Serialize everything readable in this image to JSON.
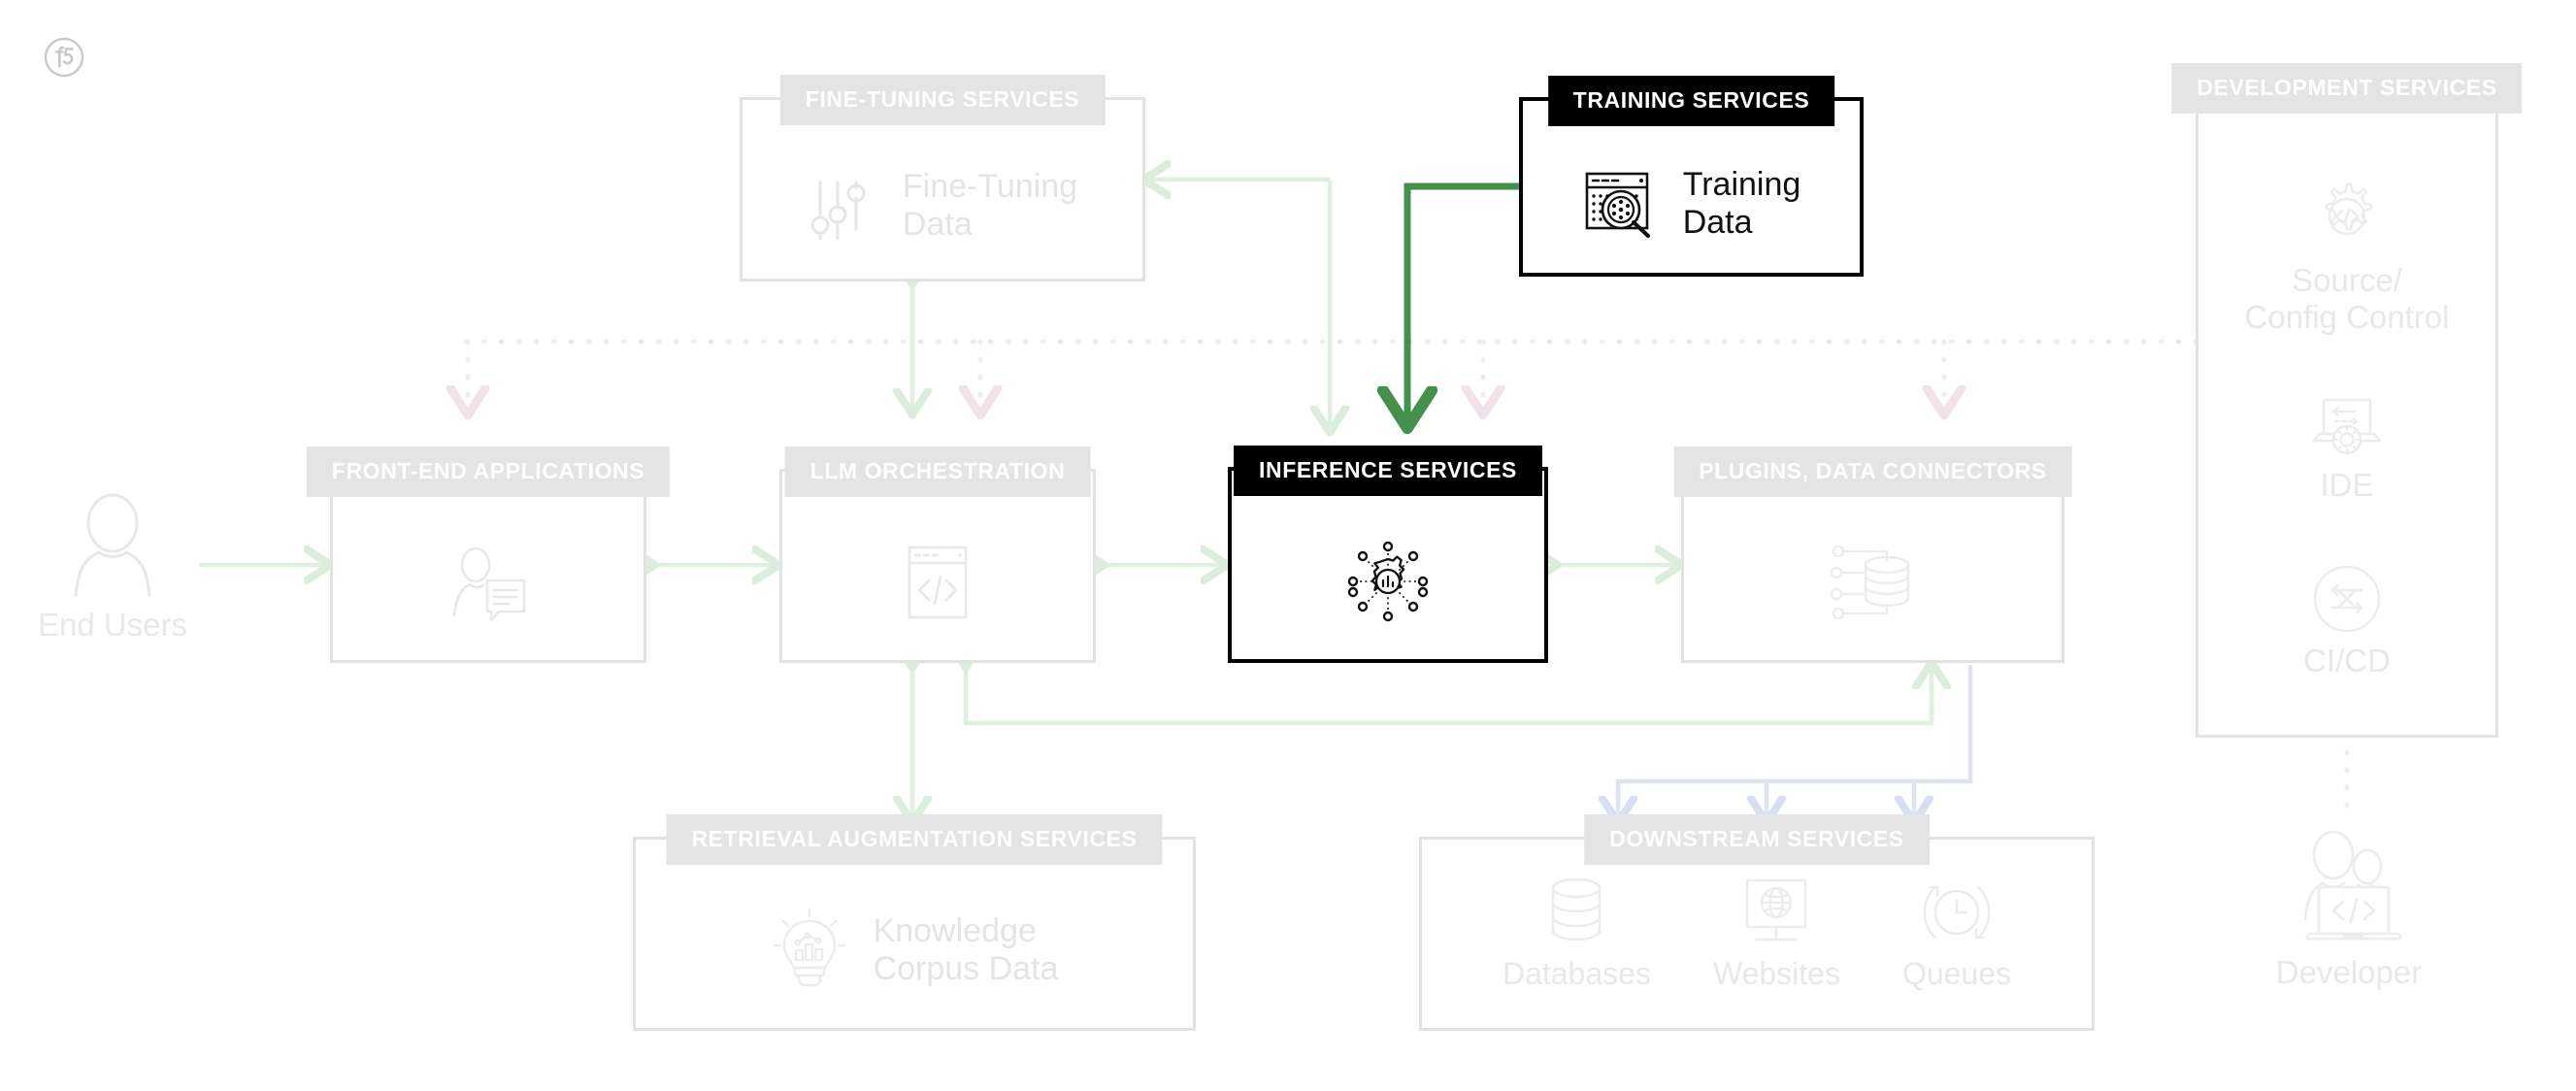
{
  "brand": {
    "logo_alt": "f5",
    "logo_color": "#c9c9c9"
  },
  "colors": {
    "active": "#000000",
    "faded_border": "#e2e2e2",
    "faded_text": "#e4e4e4",
    "title_chip": "#e4e4e4",
    "accent_green": "#43914a",
    "faded_green": "#dff0e0",
    "faded_blue": "#dfe3f4",
    "faded_pink": "#f7e9ef"
  },
  "nodes": {
    "fine_tuning": {
      "title": "FINE-TUNING SERVICES",
      "item_label": "Fine-Tuning\nData",
      "icon": "sliders-icon",
      "state": "faded"
    },
    "training": {
      "title": "TRAINING SERVICES",
      "item_label": "Training\nData",
      "icon": "data-inspect-icon",
      "state": "active"
    },
    "development": {
      "title": "DEVELOPMENT\nSERVICES",
      "state": "faded",
      "items": [
        {
          "label": "Source/\nConfig Control",
          "icon": "gear-code-icon"
        },
        {
          "label": "IDE",
          "icon": "laptop-gear-icon"
        },
        {
          "label": "CI/CD",
          "icon": "swap-arrows-icon"
        }
      ]
    },
    "front_end": {
      "title": "FRONT-END\nAPPLICATIONS",
      "icon": "person-chat-icon",
      "state": "faded"
    },
    "llm_orchestration": {
      "title": "LLM\nORCHESTRATION",
      "icon": "code-window-icon",
      "state": "faded"
    },
    "inference": {
      "title": "INFERENCE\nSERVICES",
      "icon": "inference-hub-icon",
      "state": "active"
    },
    "plugins": {
      "title": "PLUGINS,\nDATA CONNECTORS",
      "icon": "db-connector-icon",
      "state": "faded"
    },
    "retrieval": {
      "title": "RETRIEVAL AUGMENTATION SERVICES",
      "item_label": "Knowledge\nCorpus Data",
      "icon": "lightbulb-chart-icon",
      "state": "faded"
    },
    "downstream": {
      "title": "DOWNSTREAM SERVICES",
      "state": "faded",
      "items": [
        {
          "label": "Databases",
          "icon": "database-icon"
        },
        {
          "label": "Websites",
          "icon": "monitor-globe-icon"
        },
        {
          "label": "Queues",
          "icon": "queue-clock-icon"
        }
      ]
    }
  },
  "actors": {
    "end_users": {
      "label": "End Users",
      "icon": "person-icon"
    },
    "developer": {
      "label": "Developer",
      "icon": "developer-laptop-icon"
    }
  }
}
